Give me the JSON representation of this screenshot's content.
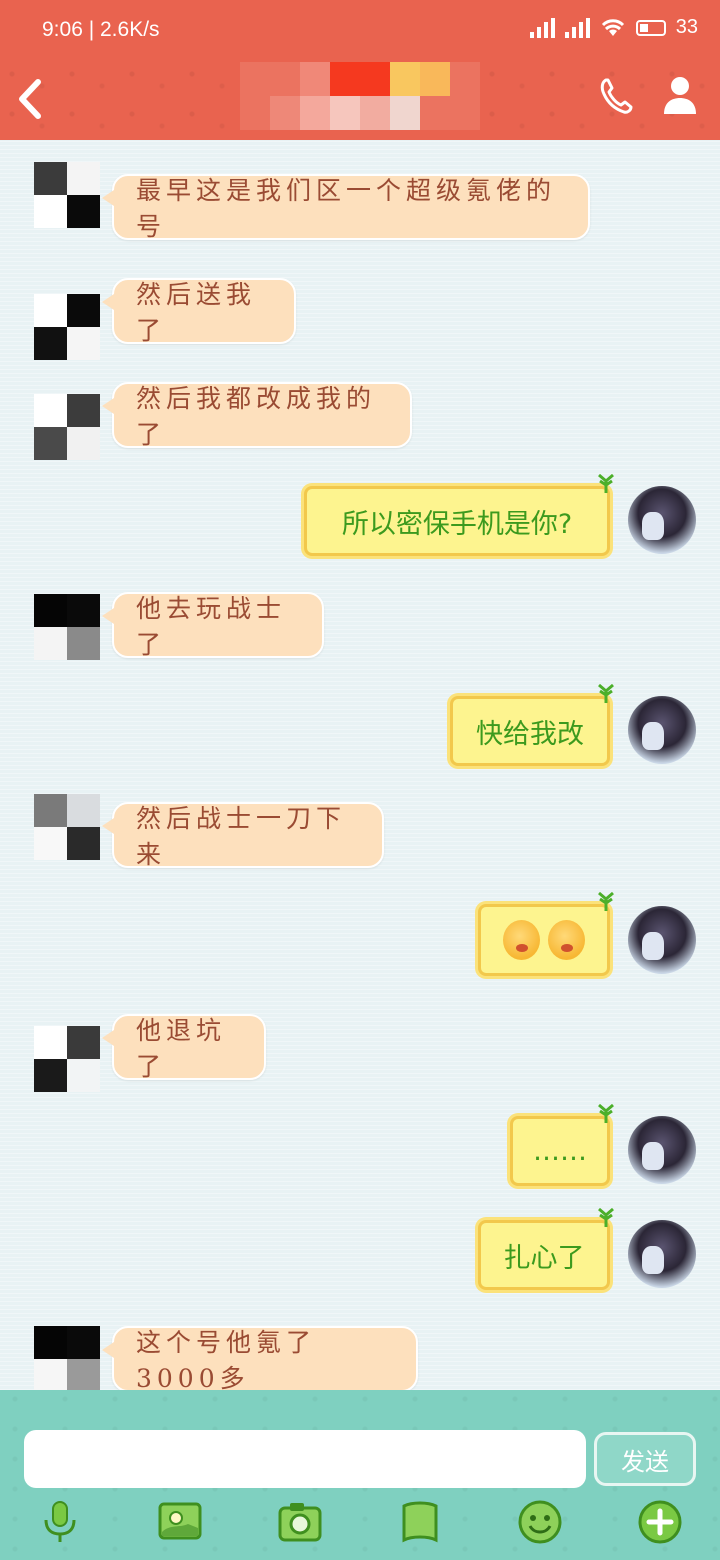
{
  "status_bar": {
    "time": "9:06",
    "net_speed": "2.6K/s",
    "battery": "33"
  },
  "header": {
    "back_icon": "chevron-left-icon",
    "call_icon": "phone-icon",
    "profile_icon": "person-icon",
    "title_is_pixelated": true
  },
  "messages": [
    {
      "dir": "in",
      "text": "最早这是我们区一个超级氪佬的号"
    },
    {
      "dir": "in",
      "text": "然后送我了"
    },
    {
      "dir": "in",
      "text": "然后我都改成我的了"
    },
    {
      "dir": "out",
      "text": "所以密保手机是你?"
    },
    {
      "dir": "in",
      "text": "他去玩战士了"
    },
    {
      "dir": "out",
      "text": "快给我改"
    },
    {
      "dir": "in",
      "text": "然后战士一刀下来"
    },
    {
      "dir": "out",
      "text": "",
      "emoji": [
        "smirk-emoji",
        "smirk-emoji"
      ]
    },
    {
      "dir": "in",
      "text": "他退坑了"
    },
    {
      "dir": "out",
      "text": "……"
    },
    {
      "dir": "out",
      "text": "扎心了"
    },
    {
      "dir": "in",
      "text": "这个号他氪了3000多"
    }
  ],
  "composer": {
    "input_value": "",
    "send_label": "发送"
  },
  "toolbar": {
    "items": [
      "microphone-icon",
      "image-icon",
      "camera-icon",
      "file-icon",
      "emoji-icon",
      "plus-icon"
    ]
  },
  "colors": {
    "header_bg": "#e9634f",
    "chat_bg": "#e8f2f4",
    "incoming_bubble": "#fde0bd",
    "incoming_text": "#9a4b33",
    "outgoing_bubble": "#fdf48f",
    "outgoing_text": "#3c9a1e",
    "bottom_bar": "#7fd0c0"
  }
}
